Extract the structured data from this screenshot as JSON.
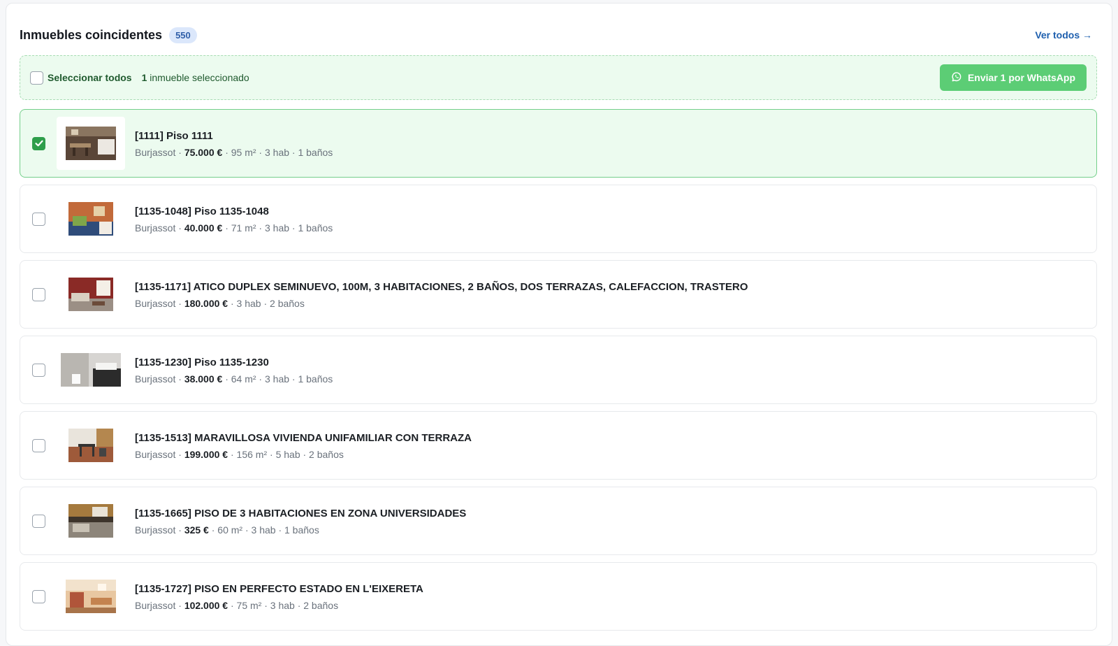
{
  "header": {
    "title": "Inmuebles coincidentes",
    "count": "550",
    "view_all": "Ver todos →"
  },
  "selection_bar": {
    "select_all_label": "Seleccionar todos",
    "selected_count": "1",
    "selected_text": "inmueble seleccionado",
    "whatsapp_button": "Enviar 1 por WhatsApp"
  },
  "properties": [
    {
      "title": "[1111] Piso 1111",
      "location": "Burjassot",
      "price": "75.000 €",
      "details": " · 95 m² · 3 hab · 1 baños",
      "selected": true,
      "thumb_icon": "photo-dining-room"
    },
    {
      "title": "[1135-1048] Piso 1135-1048",
      "location": "Burjassot",
      "price": "40.000 €",
      "details": " · 71 m² · 3 hab · 1 baños",
      "selected": false,
      "thumb_icon": "photo-bedroom"
    },
    {
      "title": "[1135-1171] ATICO DUPLEX SEMINUEVO, 100M, 3 HABITACIONES, 2 BAÑOS, DOS TERRAZAS, CALEFACCION, TRASTERO",
      "location": "Burjassot",
      "price": "180.000 €",
      "details": " · 3 hab · 2 baños",
      "selected": false,
      "thumb_icon": "photo-living-room"
    },
    {
      "title": "[1135-1230] Piso 1135-1230",
      "location": "Burjassot",
      "price": "38.000 €",
      "details": " · 64 m² · 3 hab · 1 baños",
      "selected": false,
      "thumb_icon": "photo-bathroom"
    },
    {
      "title": "[1135-1513] MARAVILLOSA VIVIENDA UNIFAMILIAR CON TERRAZA",
      "location": "Burjassot",
      "price": "199.000 €",
      "details": " · 156 m² · 5 hab · 2 baños",
      "selected": false,
      "thumb_icon": "photo-terrace"
    },
    {
      "title": "[1135-1665] PISO DE 3 HABITACIONES EN ZONA UNIVERSIDADES",
      "location": "Burjassot",
      "price": "325 €",
      "details": " · 60 m² · 3 hab · 1 baños",
      "selected": false,
      "thumb_icon": "photo-kitchen"
    },
    {
      "title": "[1135-1727] PISO EN PERFECTO ESTADO EN L'EIXERETA",
      "location": "Burjassot",
      "price": "102.000 €",
      "details": " · 75 m² · 3 hab · 2 baños",
      "selected": false,
      "thumb_icon": "photo-salon"
    }
  ],
  "colors": {
    "accent_green": "#2e9e4b",
    "whatsapp_green": "#5ccd75",
    "link_blue": "#1e5fae",
    "selected_bg": "#ecfbef"
  }
}
